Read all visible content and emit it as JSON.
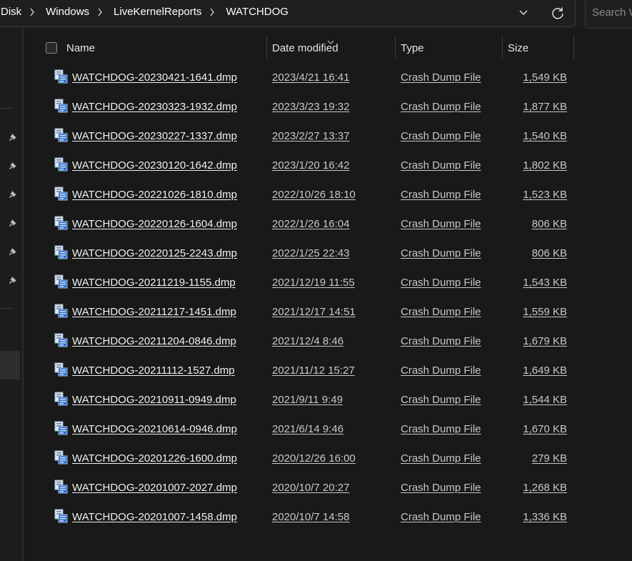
{
  "breadcrumb": {
    "items": [
      "Disk",
      "Windows",
      "LiveKernelReports",
      "WATCHDOG"
    ]
  },
  "search": {
    "placeholder": "Search W"
  },
  "columns": {
    "name": "Name",
    "date_modified": "Date modified",
    "type": "Type",
    "size": "Size"
  },
  "files": [
    {
      "name": "WATCHDOG-20230421-1641.dmp",
      "date": "2023/4/21 16:41",
      "type": "Crash Dump File",
      "size": "1,549 KB"
    },
    {
      "name": "WATCHDOG-20230323-1932.dmp",
      "date": "2023/3/23 19:32",
      "type": "Crash Dump File",
      "size": "1,877 KB"
    },
    {
      "name": "WATCHDOG-20230227-1337.dmp",
      "date": "2023/2/27 13:37",
      "type": "Crash Dump File",
      "size": "1,540 KB"
    },
    {
      "name": "WATCHDOG-20230120-1642.dmp",
      "date": "2023/1/20 16:42",
      "type": "Crash Dump File",
      "size": "1,802 KB"
    },
    {
      "name": "WATCHDOG-20221026-1810.dmp",
      "date": "2022/10/26 18:10",
      "type": "Crash Dump File",
      "size": "1,523 KB"
    },
    {
      "name": "WATCHDOG-20220126-1604.dmp",
      "date": "2022/1/26 16:04",
      "type": "Crash Dump File",
      "size": "806 KB"
    },
    {
      "name": "WATCHDOG-20220125-2243.dmp",
      "date": "2022/1/25 22:43",
      "type": "Crash Dump File",
      "size": "806 KB"
    },
    {
      "name": "WATCHDOG-20211219-1155.dmp",
      "date": "2021/12/19 11:55",
      "type": "Crash Dump File",
      "size": "1,543 KB"
    },
    {
      "name": "WATCHDOG-20211217-1451.dmp",
      "date": "2021/12/17 14:51",
      "type": "Crash Dump File",
      "size": "1,559 KB"
    },
    {
      "name": "WATCHDOG-20211204-0846.dmp",
      "date": "2021/12/4 8:46",
      "type": "Crash Dump File",
      "size": "1,679 KB"
    },
    {
      "name": "WATCHDOG-20211112-1527.dmp",
      "date": "2021/11/12 15:27",
      "type": "Crash Dump File",
      "size": "1,649 KB"
    },
    {
      "name": "WATCHDOG-20210911-0949.dmp",
      "date": "2021/9/11 9:49",
      "type": "Crash Dump File",
      "size": "1,544 KB"
    },
    {
      "name": "WATCHDOG-20210614-0946.dmp",
      "date": "2021/6/14 9:46",
      "type": "Crash Dump File",
      "size": "1,670 KB"
    },
    {
      "name": "WATCHDOG-20201226-1600.dmp",
      "date": "2020/12/26 16:00",
      "type": "Crash Dump File",
      "size": "279 KB"
    },
    {
      "name": "WATCHDOG-20201007-2027.dmp",
      "date": "2020/10/7 20:27",
      "type": "Crash Dump File",
      "size": "1,268 KB"
    },
    {
      "name": "WATCHDOG-20201007-1458.dmp",
      "date": "2020/10/7 14:58",
      "type": "Crash Dump File",
      "size": "1,336 KB"
    }
  ],
  "icons": {
    "chevron": "chevron-down-icon",
    "refresh": "refresh-icon",
    "pin": "pin-icon",
    "file": "dump-file-icon",
    "sort": "sort-indicator-icon"
  },
  "colors": {
    "background": "#191919",
    "text": "#ffffff",
    "icon_blue": "#4a90d9"
  }
}
